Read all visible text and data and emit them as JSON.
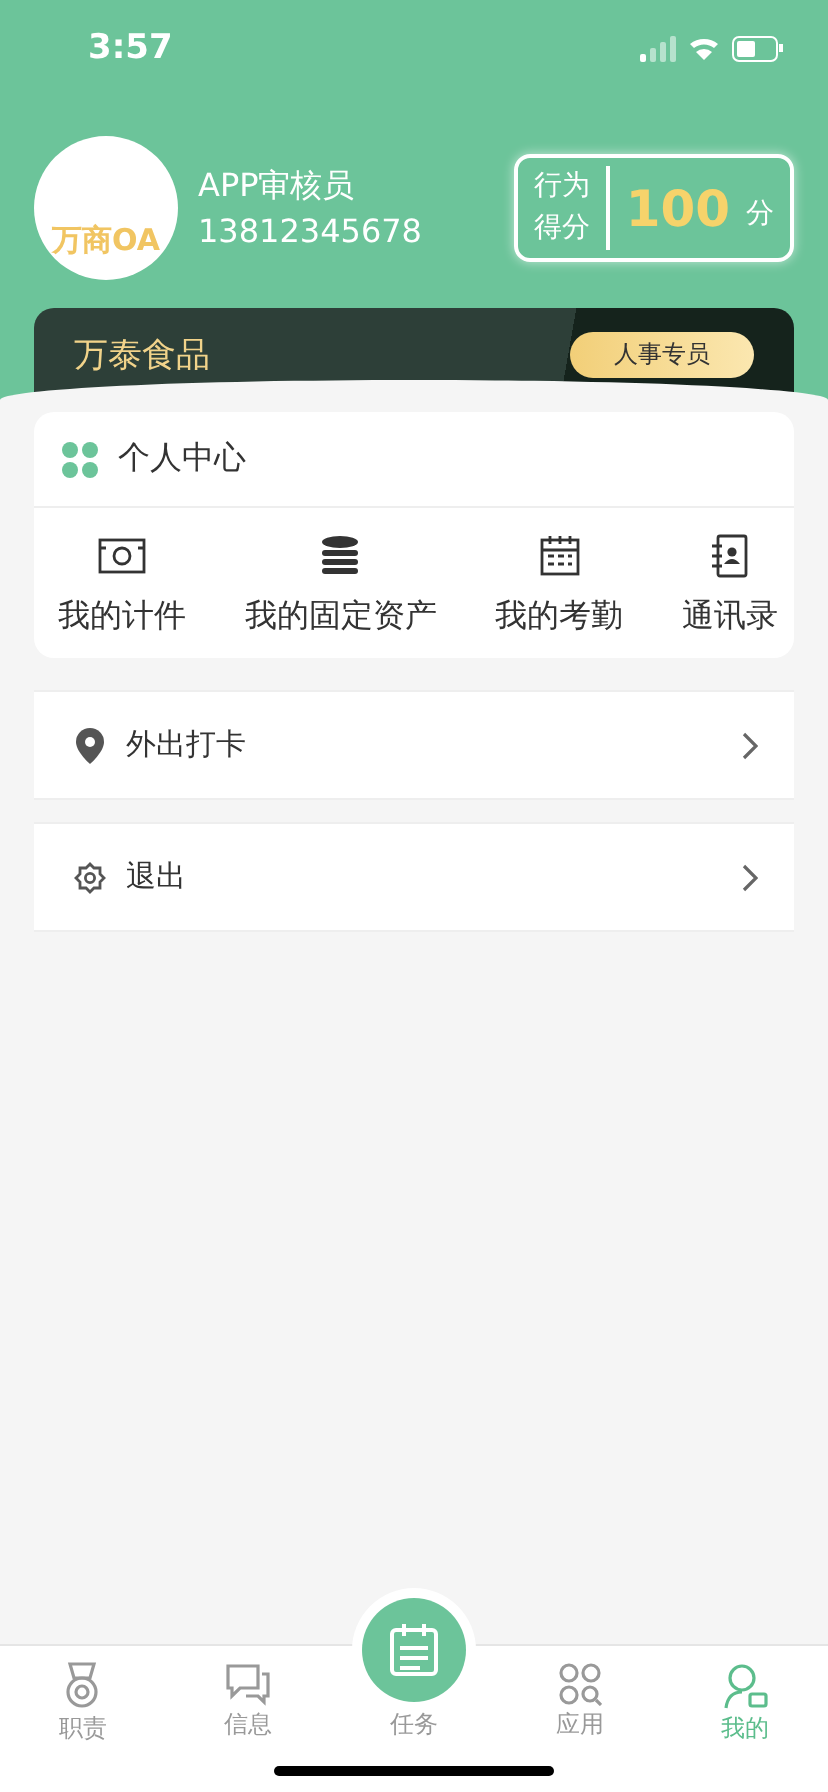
{
  "status_bar": {
    "time": "3:57"
  },
  "profile": {
    "logo_text": "万商OA",
    "name": "APP审核员",
    "phone": "13812345678",
    "score_label_1": "行为",
    "score_label_2": "得分",
    "score": "100",
    "score_unit": "分"
  },
  "company": {
    "name": "万泰食品",
    "role": "人事专员"
  },
  "personal_center": {
    "title": "个人中心",
    "items": [
      {
        "kind": "piece",
        "label": "我的计件"
      },
      {
        "kind": "assets",
        "label": "我的固定资产"
      },
      {
        "kind": "attendance",
        "label": "我的考勤"
      },
      {
        "kind": "contacts",
        "label": "通讯录"
      }
    ]
  },
  "menu": [
    {
      "kind": "location",
      "label": "外出打卡"
    },
    {
      "kind": "logout",
      "label": "退出"
    }
  ],
  "tab_bar": [
    {
      "kind": "duty",
      "label": "职责",
      "selected": false
    },
    {
      "kind": "message",
      "label": "信息",
      "selected": false
    },
    {
      "kind": "task",
      "label": "任务",
      "selected": false
    },
    {
      "kind": "apps",
      "label": "应用",
      "selected": false
    },
    {
      "kind": "me",
      "label": "我的",
      "selected": true
    }
  ]
}
